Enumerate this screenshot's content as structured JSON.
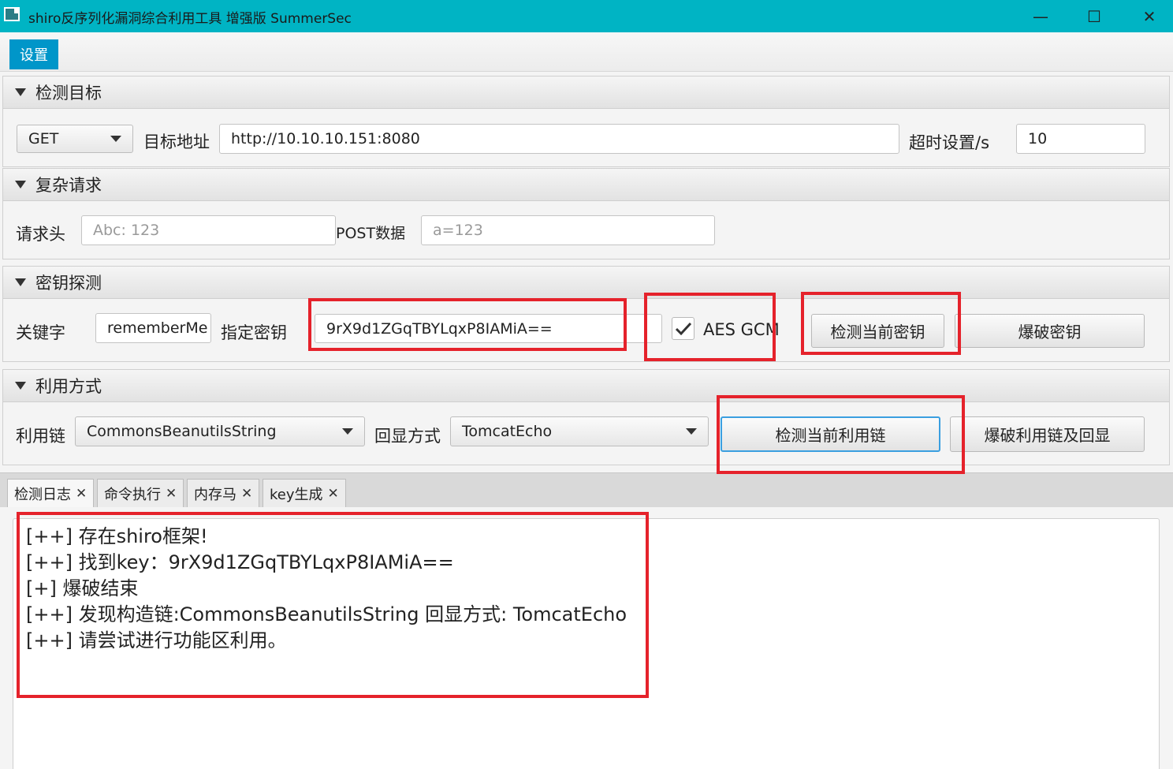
{
  "window": {
    "title": "shiro反序列化漏洞综合利用工具 增强版 SummerSec",
    "minimize": "—",
    "maximize": "☐",
    "close": "✕"
  },
  "menu": {
    "settings": "设置"
  },
  "target_panel": {
    "title": "检测目标",
    "method": "GET",
    "url_label": "目标地址",
    "url_value": "http://10.10.10.151:8080",
    "timeout_label": "超时设置/s",
    "timeout_value": "10"
  },
  "complex_panel": {
    "title": "复杂请求",
    "header_label": "请求头",
    "header_placeholder": "Abc: 123",
    "post_label": "POST数据",
    "post_placeholder": "a=123"
  },
  "key_panel": {
    "title": "密钥探测",
    "keyword_label": "关键字",
    "keyword_value": "rememberMe",
    "key_label": "指定密钥",
    "key_value": "9rX9d1ZGqTBYLqxP8IAMiA==",
    "aes_gcm_label": "AES GCM",
    "aes_gcm_checked": true,
    "detect_key_button": "检测当前密钥",
    "brute_key_button": "爆破密钥"
  },
  "exploit_panel": {
    "title": "利用方式",
    "chain_label": "利用链",
    "chain_value": "CommonsBeanutilsString",
    "echo_label": "回显方式",
    "echo_value": "TomcatEcho",
    "detect_chain_button": "检测当前利用链",
    "brute_chain_button": "爆破利用链及回显"
  },
  "tabs": [
    {
      "label": "检测日志",
      "close": "✕"
    },
    {
      "label": "命令执行",
      "close": "✕"
    },
    {
      "label": "内存马",
      "close": "✕"
    },
    {
      "label": "key生成",
      "close": "✕"
    }
  ],
  "log": [
    "[++] 存在shiro框架!",
    "[++] 找到key：9rX9d1ZGqTBYLqxP8IAMiA==",
    "[+] 爆破结束",
    "[++] 发现构造链:CommonsBeanutilsString  回显方式: TomcatEcho",
    "[++] 请尝试进行功能区利用。"
  ],
  "colors": {
    "titlebar": "#00b4c4",
    "menu_active": "#0096c9",
    "highlight_box": "#e5222b",
    "focus": "#3a9fe0"
  }
}
